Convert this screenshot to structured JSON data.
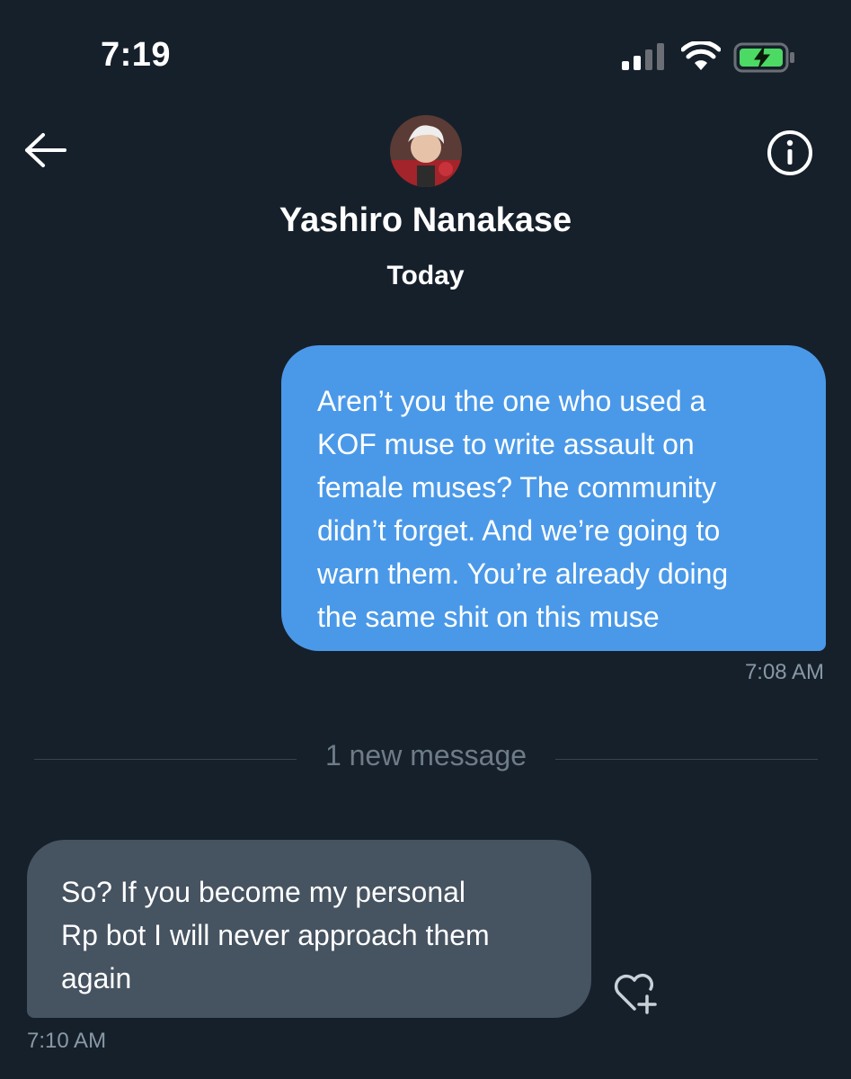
{
  "status_bar": {
    "time": "7:19",
    "icons": [
      "cellular-signal-icon",
      "wifi-icon",
      "battery-charging-icon"
    ],
    "battery_color": "#4cd964"
  },
  "header": {
    "back_icon": "back-arrow-icon",
    "info_icon": "info-icon",
    "contact_name": "Yashiro Nanakase",
    "date_label": "Today"
  },
  "messages": [
    {
      "direction": "sent",
      "text": "Aren’t you the one who used a\nKOF muse to write assault on\nfemale muses? The community\ndidn’t forget. And we’re going to\nwarn them. You’re already doing\nthe same shit on this muse",
      "time": "7:08 AM"
    },
    {
      "direction": "received",
      "text": "So? If you become my personal\nRp bot I will never approach them\nagain",
      "time": "7:10 AM"
    }
  ],
  "divider": {
    "label": "1 new message"
  },
  "reaction": {
    "icon": "add-reaction-heart-icon"
  },
  "colors": {
    "background": "#16202b",
    "sent_bubble": "#4a99e9",
    "received_bubble": "#465361",
    "muted_text": "#8899a6"
  }
}
